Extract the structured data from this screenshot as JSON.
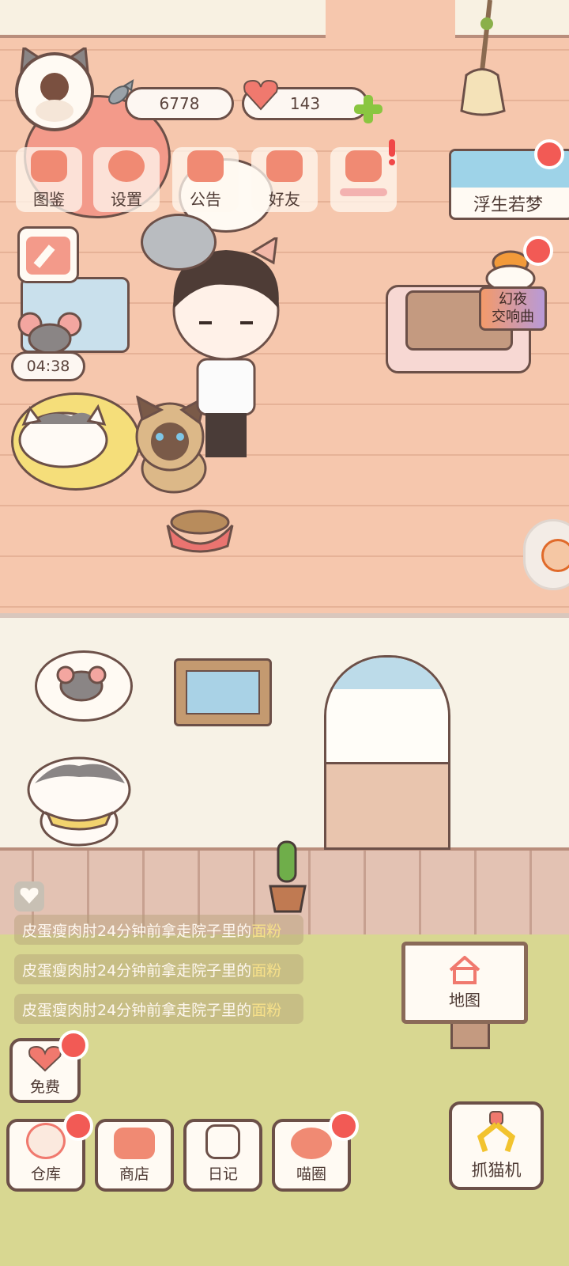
{
  "profile": {
    "avatar_alt": "player avatar"
  },
  "resources": {
    "fish_count": "6778",
    "heart_count": "143"
  },
  "top_buttons": [
    {
      "label": "图鉴"
    },
    {
      "label": "设置"
    },
    {
      "label": "公告"
    },
    {
      "label": "好友"
    },
    {
      "label": ""
    }
  ],
  "event_banner": {
    "label": "浮生若梦"
  },
  "side_event": {
    "label_line1": "幻夜",
    "label_line2": "交响曲"
  },
  "timer": {
    "value": "04:38"
  },
  "messages": [
    {
      "prefix": "皮蛋瘦肉肘24分钟前拿走院子里的",
      "item": "面粉"
    },
    {
      "prefix": "皮蛋瘦肉肘24分钟前拿走院子里的",
      "item": "面粉"
    },
    {
      "prefix": "皮蛋瘦肉肘24分钟前拿走院子里的",
      "item": "面粉"
    }
  ],
  "map_button": {
    "label": "地图"
  },
  "free_button": {
    "label": "免费"
  },
  "bottom_nav": [
    {
      "label": "仓库"
    },
    {
      "label": "商店"
    },
    {
      "label": "日记"
    },
    {
      "label": "喵圈"
    }
  ],
  "claw_machine": {
    "label": "抓猫机"
  },
  "colors": {
    "accent": "#f08a73",
    "badge": "#f25a55",
    "outline": "#6c5048",
    "yard": "#d8d791"
  }
}
